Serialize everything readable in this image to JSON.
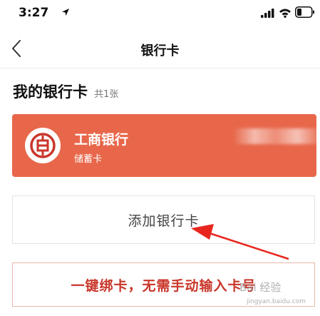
{
  "status_bar": {
    "time": "3:27",
    "icons": [
      "location-arrow-icon",
      "signal-icon",
      "wifi-icon",
      "battery-icon"
    ]
  },
  "nav": {
    "back_icon": "chevron-left-icon",
    "title": "银行卡"
  },
  "section": {
    "title": "我的银行卡",
    "count": "共1张"
  },
  "card": {
    "bank_name": "工商银行",
    "card_type": "储蓄卡",
    "logo_icon": "icbc-logo-icon",
    "background_color": "#e8674a"
  },
  "add_card": {
    "label": "添加银行卡"
  },
  "quick_bind": {
    "label": "一键绑卡，无需手动输入卡号"
  },
  "watermark": {
    "text": "Bai 经验",
    "subtext": "jingyan.baidu.com"
  },
  "annotation": {
    "arrow_color": "#e8261e"
  }
}
